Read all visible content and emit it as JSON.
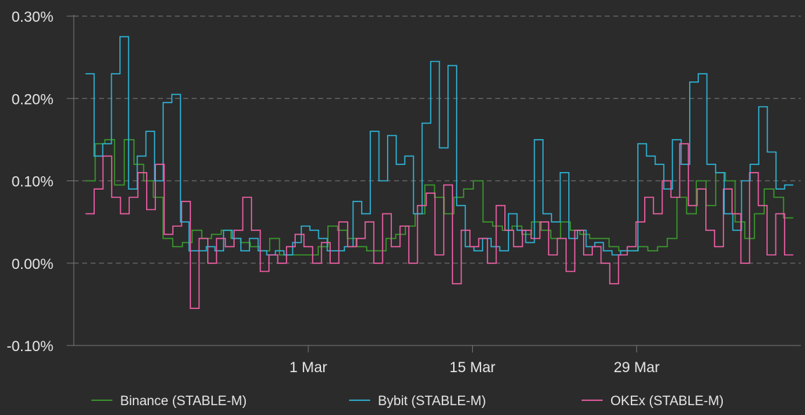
{
  "chart_data": {
    "type": "line",
    "step": true,
    "background": "#2b2b2b",
    "grid": "horizontal-dashed",
    "legend_position": "bottom",
    "y_unit": "%",
    "ylim": [
      -0.1,
      0.3
    ],
    "y_ticks": [
      {
        "value": 0.3,
        "label": "0.30%"
      },
      {
        "value": 0.2,
        "label": "0.20%"
      },
      {
        "value": 0.1,
        "label": "0.10%"
      },
      {
        "value": 0.0,
        "label": "0.00%"
      },
      {
        "value": -0.1,
        "label": "-0.10%"
      }
    ],
    "xlim": [
      "2021-02-09",
      "2021-04-12"
    ],
    "x_ticks": [
      {
        "value": "2021-03-01",
        "label": "1 Mar"
      },
      {
        "value": "2021-03-15",
        "label": "15 Mar"
      },
      {
        "value": "2021-03-29",
        "label": "29 Mar"
      }
    ],
    "x": [
      "2021-02-10",
      "2021-02-11",
      "2021-02-12",
      "2021-02-13",
      "2021-02-14",
      "2021-02-15",
      "2021-02-16",
      "2021-02-17",
      "2021-02-18",
      "2021-02-19",
      "2021-02-20",
      "2021-02-21",
      "2021-02-22",
      "2021-02-23",
      "2021-02-24",
      "2021-02-25",
      "2021-02-26",
      "2021-02-27",
      "2021-02-28",
      "2021-03-01",
      "2021-03-02",
      "2021-03-03",
      "2021-03-04",
      "2021-03-05",
      "2021-03-06",
      "2021-03-07",
      "2021-03-08",
      "2021-03-09",
      "2021-03-10",
      "2021-03-11",
      "2021-03-12",
      "2021-03-13",
      "2021-03-14",
      "2021-03-15",
      "2021-03-16",
      "2021-03-17",
      "2021-03-18",
      "2021-03-19",
      "2021-03-20",
      "2021-03-21",
      "2021-03-22",
      "2021-03-23",
      "2021-03-24",
      "2021-03-25",
      "2021-03-26",
      "2021-03-27",
      "2021-03-28",
      "2021-03-29",
      "2021-03-30",
      "2021-03-31",
      "2021-04-01",
      "2021-04-02",
      "2021-04-03",
      "2021-04-04",
      "2021-04-05",
      "2021-04-06",
      "2021-04-07",
      "2021-04-08",
      "2021-04-09",
      "2021-04-10",
      "2021-04-11"
    ],
    "series": [
      {
        "name": "Binance (STABLE-M)",
        "color": "#3a9a2c",
        "values": [
          0.1,
          0.145,
          0.15,
          0.095,
          0.15,
          0.12,
          0.1,
          0.08,
          0.03,
          0.02,
          0.025,
          0.04,
          0.03,
          0.035,
          0.04,
          0.03,
          0.025,
          0.02,
          0.015,
          0.03,
          0.01,
          0.01,
          0.01,
          0.01,
          0.02,
          0.045,
          0.04,
          0.03,
          0.02,
          0.015,
          0.015,
          0.03,
          0.035,
          0.045,
          0.06,
          0.095,
          0.08,
          0.06,
          0.08,
          0.09,
          0.1,
          0.05,
          0.045,
          0.04,
          0.045,
          0.035,
          0.05,
          0.04,
          0.03,
          0.05,
          0.04,
          0.035,
          0.03,
          0.03,
          0.02,
          0.015,
          0.015,
          0.02,
          0.015,
          0.02,
          0.03,
          0.08,
          0.06,
          0.1,
          0.07,
          0.11,
          0.1,
          0.05,
          0.03,
          0.06,
          0.09,
          0.08,
          0.055
        ]
      },
      {
        "name": "Bybit (STABLE-M)",
        "color": "#2eb4d6",
        "values": [
          0.23,
          0.13,
          0.145,
          0.23,
          0.275,
          0.09,
          0.13,
          0.16,
          0.1,
          0.195,
          0.205,
          0.05,
          0.015,
          0.015,
          0.02,
          0.015,
          0.04,
          0.03,
          0.015,
          0.03,
          0.015,
          0.01,
          0.015,
          0.01,
          0.025,
          0.045,
          0.04,
          0.03,
          0.015,
          0.015,
          0.02,
          0.075,
          0.06,
          0.16,
          0.1,
          0.155,
          0.12,
          0.13,
          0.06,
          0.17,
          0.245,
          0.14,
          0.24,
          0.07,
          0.02,
          0.015,
          0.03,
          0.02,
          0.015,
          0.06,
          0.04,
          0.025,
          0.15,
          0.06,
          0.05,
          0.11,
          0.03,
          0.04,
          0.02,
          0.025,
          0.015,
          0.01,
          0.015,
          0.015,
          0.145,
          0.13,
          0.12,
          0.09,
          0.15,
          0.12,
          0.22,
          0.23,
          0.12,
          0.11,
          0.06,
          0.04,
          0.1,
          0.12,
          0.19,
          0.135,
          0.09,
          0.095
        ]
      },
      {
        "name": "OKEx (STABLE-M)",
        "color": "#ef5fa7",
        "values": [
          0.06,
          0.09,
          0.13,
          0.08,
          0.06,
          0.08,
          0.11,
          0.065,
          0.12,
          0.035,
          0.045,
          0.075,
          -0.055,
          0.03,
          0.0,
          0.03,
          0.02,
          0.04,
          0.08,
          0.04,
          -0.01,
          0.01,
          0.0,
          0.02,
          0.035,
          0.02,
          0.0,
          0.025,
          0.0,
          0.05,
          0.02,
          0.03,
          0.05,
          0.0,
          0.06,
          0.02,
          0.045,
          0.0,
          0.07,
          0.085,
          0.01,
          0.095,
          -0.025,
          0.04,
          0.02,
          0.03,
          0.0,
          0.07,
          0.04,
          0.02,
          0.04,
          0.03,
          0.05,
          0.01,
          0.03,
          -0.01,
          0.04,
          0.01,
          0.02,
          0.0,
          -0.025,
          0.01,
          0.02,
          0.05,
          0.08,
          0.06,
          0.1,
          0.08,
          0.145,
          0.07,
          0.09,
          0.04,
          0.02,
          0.09,
          0.06,
          0.0,
          0.11,
          0.07,
          0.01,
          0.06,
          0.01
        ]
      }
    ]
  }
}
